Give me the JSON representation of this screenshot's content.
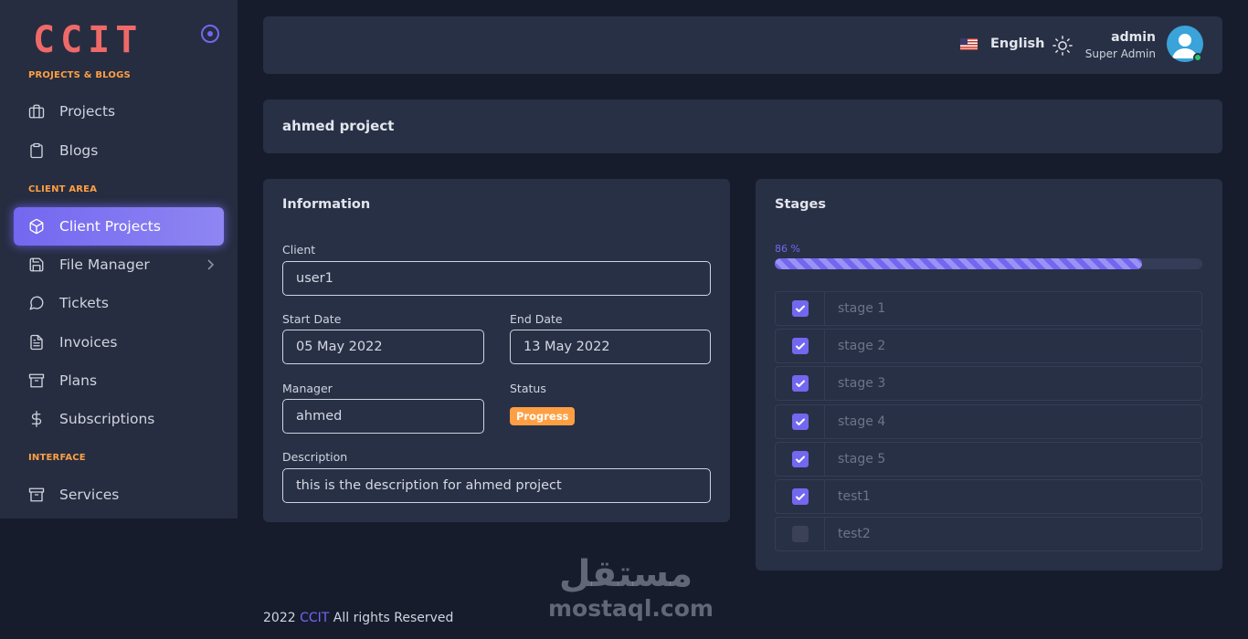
{
  "brand": {
    "logo_text": "CCIT",
    "logo_color": "#ef6969",
    "accent": "#7367f0",
    "warning": "#ff9f43"
  },
  "sidebar": {
    "sections": [
      {
        "title": "PROJECTS & BLOGS"
      },
      {
        "title": "CLIENT AREA"
      },
      {
        "title": "INTERFACE"
      }
    ],
    "items": [
      {
        "label": "Projects",
        "icon": "briefcase-icon"
      },
      {
        "label": "Blogs",
        "icon": "clipboard-icon"
      },
      {
        "label": "Client Projects",
        "icon": "box-icon",
        "active": true
      },
      {
        "label": "File Manager",
        "icon": "save-icon",
        "has_submenu": true
      },
      {
        "label": "Tickets",
        "icon": "message-circle-icon"
      },
      {
        "label": "Invoices",
        "icon": "file-text-icon"
      },
      {
        "label": "Plans",
        "icon": "archive-icon"
      },
      {
        "label": "Subscriptions",
        "icon": "dollar-icon"
      },
      {
        "label": "Services",
        "icon": "archive-icon"
      }
    ]
  },
  "header": {
    "language": "English",
    "user_name": "admin",
    "user_role": "Super Admin"
  },
  "page": {
    "title": "ahmed project"
  },
  "information": {
    "title": "Information",
    "client_label": "Client",
    "client_value": "user1",
    "start_date_label": "Start Date",
    "start_date_value": "05 May 2022",
    "end_date_label": "End Date",
    "end_date_value": "13 May 2022",
    "manager_label": "Manager",
    "manager_value": "ahmed",
    "status_label": "Status",
    "status_value": "Progress",
    "description_label": "Description",
    "description_value": "this is the description for ahmed project"
  },
  "stages": {
    "title": "Stages",
    "progress_text": "86 %",
    "progress": 0.86,
    "items": [
      {
        "label": "stage 1",
        "checked": true
      },
      {
        "label": "stage 2",
        "checked": true
      },
      {
        "label": "stage 3",
        "checked": true
      },
      {
        "label": "stage 4",
        "checked": true
      },
      {
        "label": "stage 5",
        "checked": true
      },
      {
        "label": "test1",
        "checked": true
      },
      {
        "label": "test2",
        "checked": false
      }
    ]
  },
  "footer": {
    "year": "2022",
    "brand": "CCIT",
    "rights": "All rights Reserved"
  },
  "watermark": {
    "arabic": "مستقل",
    "latin": "mostaql.com"
  }
}
